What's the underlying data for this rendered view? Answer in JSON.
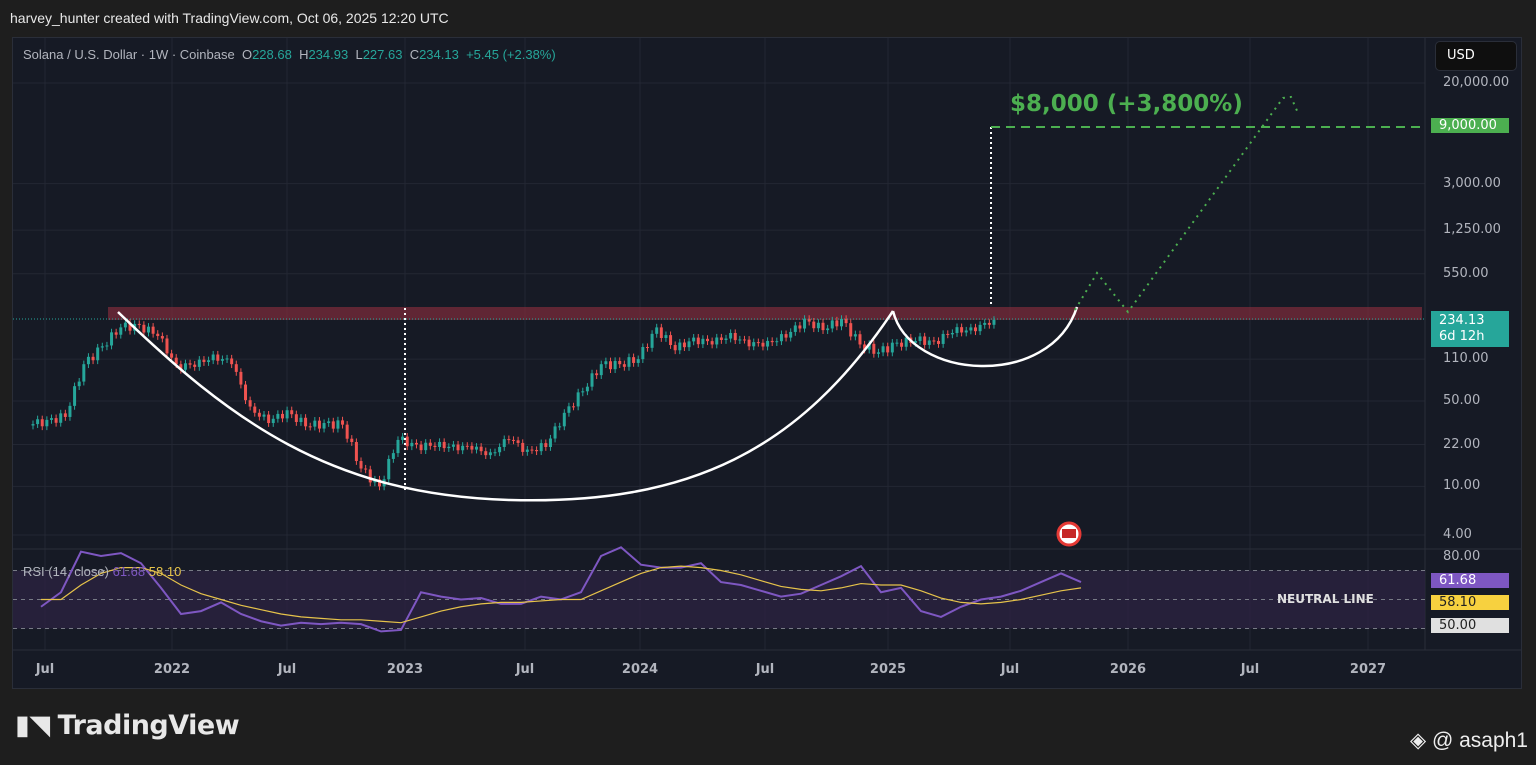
{
  "caption": "harvey_hunter created with TradingView.com, Oct 06, 2025 12:20 UTC",
  "legend": {
    "symbol": "Solana / U.S. Dollar · 1W · Coinbase",
    "o_label": "O",
    "o": "228.68",
    "h_label": "H",
    "h": "234.93",
    "l_label": "L",
    "l": "227.63",
    "c_label": "C",
    "c": "234.13",
    "change": "+5.45 (+2.38%)"
  },
  "currency": "USD",
  "price_axis": [
    "20,000.00",
    "3,000.00",
    "1,250.00",
    "550.00",
    "110.00",
    "50.00",
    "22.00",
    "10.00",
    "4.00"
  ],
  "price_axis_values": [
    20000,
    3000,
    1250,
    550,
    110,
    50,
    22,
    10,
    4
  ],
  "target_tag": "9,000.00",
  "last_price": "234.13",
  "countdown": "6d 12h",
  "annotation": {
    "target_text": "$8,000 (+3,800%)",
    "neutral_text": "NEUTRAL LINE"
  },
  "rsi": {
    "label": "RSI (14, close)",
    "value": "61.68",
    "ma": "58.10",
    "axis_top": "80.00",
    "axis_50": "50.00"
  },
  "time_axis": [
    "Jul",
    "2022",
    "Jul",
    "2023",
    "Jul",
    "2024",
    "Jul",
    "2025",
    "Jul",
    "2026",
    "Jul",
    "2027"
  ],
  "colors": {
    "up": "#26a69a",
    "down": "#ef5350",
    "rsi": "#7e57c2",
    "rsi_ma": "#e6c34a",
    "target": "#4caf50"
  },
  "branding": {
    "logo": "TradingView",
    "handle": "@ asaph1"
  },
  "chart_data": {
    "type": "candlestick",
    "title": "Solana / U.S. Dollar · 1W · Coinbase",
    "scale": "log",
    "ylim": [
      4,
      20000
    ],
    "x_start": "2021-06",
    "interval": "month",
    "closes": [
      35,
      37,
      100,
      140,
      200,
      210,
      170,
      100,
      95,
      120,
      100,
      45,
      33,
      42,
      31,
      33,
      32,
      14,
      10,
      24,
      22,
      21,
      22,
      20,
      19,
      24,
      20,
      21,
      40,
      60,
      100,
      100,
      110,
      200,
      130,
      165,
      145,
      180,
      140,
      155,
      165,
      235,
      190,
      235,
      145,
      125,
      150,
      155,
      155,
      180,
      200,
      210,
      234
    ],
    "rsi_values": [
      45,
      55,
      83,
      80,
      82,
      75,
      58,
      40,
      42,
      48,
      40,
      35,
      32,
      34,
      33,
      34,
      33,
      28,
      29,
      55,
      52,
      50,
      51,
      47,
      47,
      52,
      50,
      55,
      80,
      86,
      74,
      72,
      72,
      75,
      62,
      60,
      56,
      52,
      54,
      60,
      66,
      73,
      55,
      58,
      42,
      38,
      45,
      50,
      52,
      56,
      62,
      68,
      62
    ],
    "rsi_ma": [
      50,
      50,
      60,
      68,
      72,
      72,
      68,
      60,
      54,
      50,
      46,
      43,
      40,
      38,
      37,
      36,
      36,
      35,
      34,
      38,
      42,
      45,
      47,
      48,
      48,
      49,
      50,
      50,
      56,
      62,
      68,
      72,
      73,
      72,
      70,
      67,
      63,
      59,
      57,
      56,
      58,
      61,
      60,
      60,
      56,
      51,
      48,
      47,
      48,
      50,
      53,
      56,
      58
    ]
  }
}
